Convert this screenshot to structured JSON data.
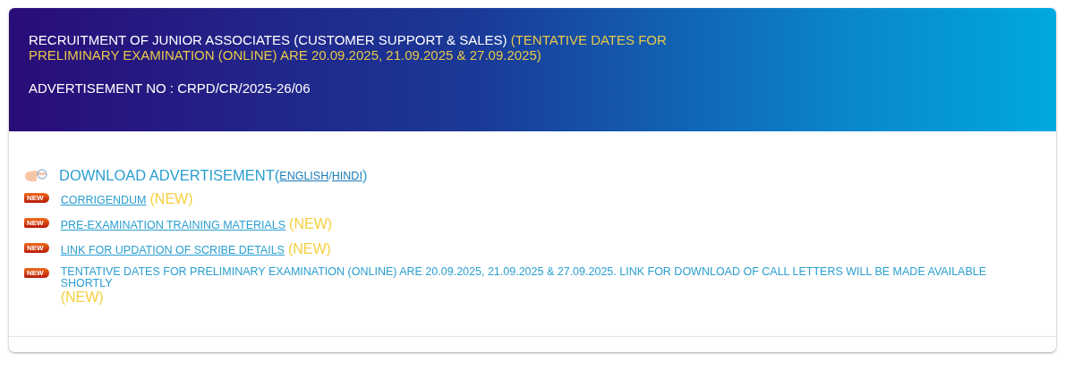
{
  "header": {
    "title": "RECRUITMENT OF JUNIOR ASSOCIATES (CUSTOMER SUPPORT & SALES)",
    "title_note": "(TENTATIVE DATES FOR PRELIMINARY EXAMINATION (ONLINE) ARE 20.09.2025, 21.09.2025 & 27.09.2025)",
    "advertisement_no": "ADVERTISEMENT NO : CRPD/CR/2025-26/06"
  },
  "items": [
    {
      "kind": "download",
      "text": "DOWNLOAD ADVERTISEMENT",
      "open": "(",
      "links": [
        "ENGLISH",
        "HINDI"
      ],
      "separator": "/",
      "close": ")"
    },
    {
      "kind": "link",
      "badge": "NEW",
      "text": "CORRIGENDUM",
      "tag": "(NEW)"
    },
    {
      "kind": "link",
      "badge": "NEW",
      "text": "PRE-EXAMINATION TRAINING MATERIALS",
      "tag": "(NEW)"
    },
    {
      "kind": "link",
      "badge": "NEW",
      "text": "LINK FOR UPDATION OF SCRIBE DETAILS",
      "tag": "(NEW)"
    },
    {
      "kind": "notice",
      "badge": "NEW",
      "text": "TENTATIVE DATES FOR PRELIMINARY EXAMINATION (ONLINE) ARE 20.09.2025, 21.09.2025 & 27.09.2025. LINK FOR DOWNLOAD OF CALL LETTERS WILL BE MADE AVAILABLE SHORTLY",
      "tag": "(NEW)"
    }
  ]
}
